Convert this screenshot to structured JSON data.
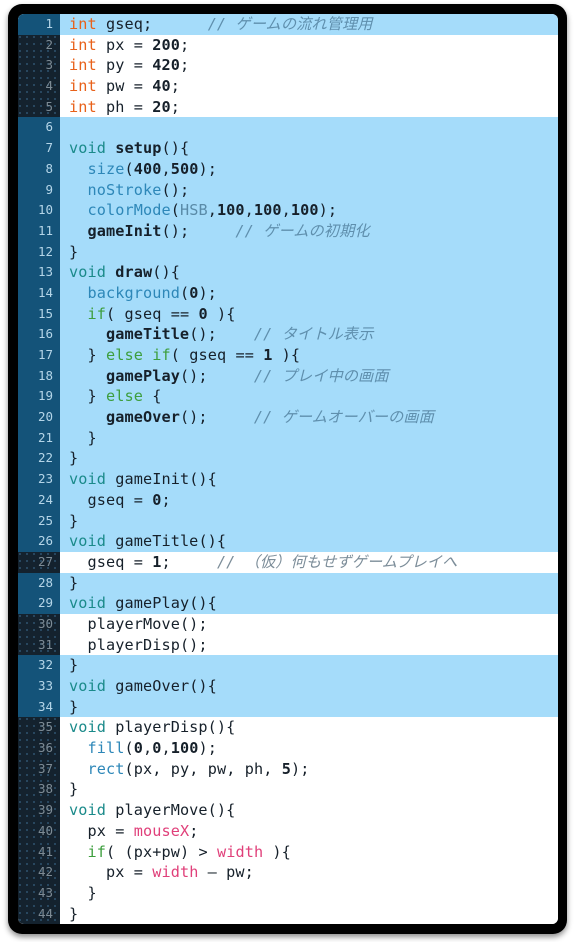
{
  "editor": {
    "name": "code-screenshot",
    "language": "Processing (Java)",
    "colors": {
      "frame": "#000000",
      "line_bg": "#ffffff",
      "line_bg_highlight": "#a5dcfa",
      "gutter_bg": "#14222e",
      "gutter_bg_highlight": "#145379",
      "gutter_text": "#7d8b95",
      "text": "#16202a",
      "type_keyword": "#e8611a",
      "void_keyword": "#1a8a8a",
      "builtin_function": "#2d87b8",
      "control_keyword": "#3d9e3d",
      "constant": "#6f8a99",
      "special_variable": "#e0407a",
      "comment": "#7c8d99"
    },
    "first_line_number": 1,
    "last_line_number": 44,
    "total_lines": 44
  },
  "lines": [
    {
      "n": "1",
      "hl": true,
      "tokens": [
        {
          "c": "t-type",
          "t": "int"
        },
        {
          "c": "t-punc",
          "t": " "
        },
        {
          "c": "t-var",
          "t": "gseq"
        },
        {
          "c": "t-punc",
          "t": ";"
        },
        {
          "c": "t-punc",
          "t": "      "
        },
        {
          "c": "t-comment",
          "t": "// ゲームの流れ管理用"
        }
      ]
    },
    {
      "n": "2",
      "hl": false,
      "tokens": [
        {
          "c": "t-type",
          "t": "int"
        },
        {
          "c": "t-punc",
          "t": " "
        },
        {
          "c": "t-var",
          "t": "px"
        },
        {
          "c": "t-punc",
          "t": " = "
        },
        {
          "c": "t-num",
          "t": "200"
        },
        {
          "c": "t-punc",
          "t": ";"
        }
      ]
    },
    {
      "n": "3",
      "hl": false,
      "tokens": [
        {
          "c": "t-type",
          "t": "int"
        },
        {
          "c": "t-punc",
          "t": " "
        },
        {
          "c": "t-var",
          "t": "py"
        },
        {
          "c": "t-punc",
          "t": " = "
        },
        {
          "c": "t-num",
          "t": "420"
        },
        {
          "c": "t-punc",
          "t": ";"
        }
      ]
    },
    {
      "n": "4",
      "hl": false,
      "tokens": [
        {
          "c": "t-type",
          "t": "int"
        },
        {
          "c": "t-punc",
          "t": " "
        },
        {
          "c": "t-var",
          "t": "pw"
        },
        {
          "c": "t-punc",
          "t": " = "
        },
        {
          "c": "t-num",
          "t": "40"
        },
        {
          "c": "t-punc",
          "t": ";"
        }
      ]
    },
    {
      "n": "5",
      "hl": false,
      "tokens": [
        {
          "c": "t-type",
          "t": "int"
        },
        {
          "c": "t-punc",
          "t": " "
        },
        {
          "c": "t-var",
          "t": "ph"
        },
        {
          "c": "t-punc",
          "t": " = "
        },
        {
          "c": "t-num",
          "t": "20"
        },
        {
          "c": "t-punc",
          "t": ";"
        }
      ]
    },
    {
      "n": "6",
      "hl": true,
      "tokens": []
    },
    {
      "n": "7",
      "hl": true,
      "tokens": [
        {
          "c": "t-void",
          "t": "void"
        },
        {
          "c": "t-punc",
          "t": " "
        },
        {
          "c": "t-fn",
          "t": "setup"
        },
        {
          "c": "t-punc",
          "t": "(){"
        }
      ]
    },
    {
      "n": "8",
      "hl": true,
      "tokens": [
        {
          "c": "t-punc",
          "t": "  "
        },
        {
          "c": "t-builtin",
          "t": "size"
        },
        {
          "c": "t-punc",
          "t": "("
        },
        {
          "c": "t-num",
          "t": "400"
        },
        {
          "c": "t-punc",
          "t": ","
        },
        {
          "c": "t-num",
          "t": "500"
        },
        {
          "c": "t-punc",
          "t": ");"
        }
      ]
    },
    {
      "n": "9",
      "hl": true,
      "tokens": [
        {
          "c": "t-punc",
          "t": "  "
        },
        {
          "c": "t-builtin",
          "t": "noStroke"
        },
        {
          "c": "t-punc",
          "t": "();"
        }
      ]
    },
    {
      "n": "10",
      "hl": true,
      "tokens": [
        {
          "c": "t-punc",
          "t": "  "
        },
        {
          "c": "t-builtin",
          "t": "colorMode"
        },
        {
          "c": "t-punc",
          "t": "("
        },
        {
          "c": "t-const",
          "t": "HSB"
        },
        {
          "c": "t-punc",
          "t": ","
        },
        {
          "c": "t-num",
          "t": "100"
        },
        {
          "c": "t-punc",
          "t": ","
        },
        {
          "c": "t-num",
          "t": "100"
        },
        {
          "c": "t-punc",
          "t": ","
        },
        {
          "c": "t-num",
          "t": "100"
        },
        {
          "c": "t-punc",
          "t": ");"
        }
      ]
    },
    {
      "n": "11",
      "hl": true,
      "tokens": [
        {
          "c": "t-punc",
          "t": "  "
        },
        {
          "c": "t-fn",
          "t": "gameInit"
        },
        {
          "c": "t-punc",
          "t": "();"
        },
        {
          "c": "t-punc",
          "t": "     "
        },
        {
          "c": "t-comment",
          "t": "// ゲームの初期化"
        }
      ]
    },
    {
      "n": "12",
      "hl": true,
      "tokens": [
        {
          "c": "t-punc",
          "t": "}"
        }
      ]
    },
    {
      "n": "13",
      "hl": true,
      "tokens": [
        {
          "c": "t-void",
          "t": "void"
        },
        {
          "c": "t-punc",
          "t": " "
        },
        {
          "c": "t-fn",
          "t": "draw"
        },
        {
          "c": "t-punc",
          "t": "(){"
        }
      ]
    },
    {
      "n": "14",
      "hl": true,
      "tokens": [
        {
          "c": "t-punc",
          "t": "  "
        },
        {
          "c": "t-builtin",
          "t": "background"
        },
        {
          "c": "t-punc",
          "t": "("
        },
        {
          "c": "t-num",
          "t": "0"
        },
        {
          "c": "t-punc",
          "t": ");"
        }
      ]
    },
    {
      "n": "15",
      "hl": true,
      "tokens": [
        {
          "c": "t-punc",
          "t": "  "
        },
        {
          "c": "t-kw",
          "t": "if"
        },
        {
          "c": "t-punc",
          "t": "( "
        },
        {
          "c": "t-var",
          "t": "gseq"
        },
        {
          "c": "t-punc",
          "t": " == "
        },
        {
          "c": "t-num",
          "t": "0"
        },
        {
          "c": "t-punc",
          "t": " ){"
        }
      ]
    },
    {
      "n": "16",
      "hl": true,
      "tokens": [
        {
          "c": "t-punc",
          "t": "    "
        },
        {
          "c": "t-fn",
          "t": "gameTitle"
        },
        {
          "c": "t-punc",
          "t": "();"
        },
        {
          "c": "t-punc",
          "t": "    "
        },
        {
          "c": "t-comment",
          "t": "// タイトル表示"
        }
      ]
    },
    {
      "n": "17",
      "hl": true,
      "tokens": [
        {
          "c": "t-punc",
          "t": "  } "
        },
        {
          "c": "t-kw",
          "t": "else"
        },
        {
          "c": "t-punc",
          "t": " "
        },
        {
          "c": "t-kw",
          "t": "if"
        },
        {
          "c": "t-punc",
          "t": "( "
        },
        {
          "c": "t-var",
          "t": "gseq"
        },
        {
          "c": "t-punc",
          "t": " == "
        },
        {
          "c": "t-num",
          "t": "1"
        },
        {
          "c": "t-punc",
          "t": " ){"
        }
      ]
    },
    {
      "n": "18",
      "hl": true,
      "tokens": [
        {
          "c": "t-punc",
          "t": "    "
        },
        {
          "c": "t-fn",
          "t": "gamePlay"
        },
        {
          "c": "t-punc",
          "t": "();"
        },
        {
          "c": "t-punc",
          "t": "     "
        },
        {
          "c": "t-comment",
          "t": "// プレイ中の画面"
        }
      ]
    },
    {
      "n": "19",
      "hl": true,
      "tokens": [
        {
          "c": "t-punc",
          "t": "  } "
        },
        {
          "c": "t-kw",
          "t": "else"
        },
        {
          "c": "t-punc",
          "t": " {"
        }
      ]
    },
    {
      "n": "20",
      "hl": true,
      "tokens": [
        {
          "c": "t-punc",
          "t": "    "
        },
        {
          "c": "t-fn",
          "t": "gameOver"
        },
        {
          "c": "t-punc",
          "t": "();"
        },
        {
          "c": "t-punc",
          "t": "     "
        },
        {
          "c": "t-comment",
          "t": "// ゲームオーバーの画面"
        }
      ]
    },
    {
      "n": "21",
      "hl": true,
      "tokens": [
        {
          "c": "t-punc",
          "t": "  }"
        }
      ]
    },
    {
      "n": "22",
      "hl": true,
      "tokens": [
        {
          "c": "t-punc",
          "t": "}"
        }
      ]
    },
    {
      "n": "23",
      "hl": true,
      "tokens": [
        {
          "c": "t-void",
          "t": "void"
        },
        {
          "c": "t-punc",
          "t": " "
        },
        {
          "c": "t-var",
          "t": "gameInit"
        },
        {
          "c": "t-punc",
          "t": "(){"
        }
      ]
    },
    {
      "n": "24",
      "hl": true,
      "tokens": [
        {
          "c": "t-punc",
          "t": "  "
        },
        {
          "c": "t-var",
          "t": "gseq"
        },
        {
          "c": "t-punc",
          "t": " = "
        },
        {
          "c": "t-num",
          "t": "0"
        },
        {
          "c": "t-punc",
          "t": ";"
        }
      ]
    },
    {
      "n": "25",
      "hl": true,
      "tokens": [
        {
          "c": "t-punc",
          "t": "}"
        }
      ]
    },
    {
      "n": "26",
      "hl": true,
      "tokens": [
        {
          "c": "t-void",
          "t": "void"
        },
        {
          "c": "t-punc",
          "t": " "
        },
        {
          "c": "t-var",
          "t": "gameTitle"
        },
        {
          "c": "t-punc",
          "t": "(){"
        }
      ]
    },
    {
      "n": "27",
      "hl": false,
      "tokens": [
        {
          "c": "t-punc",
          "t": "  "
        },
        {
          "c": "t-var",
          "t": "gseq"
        },
        {
          "c": "t-punc",
          "t": " = "
        },
        {
          "c": "t-num",
          "t": "1"
        },
        {
          "c": "t-punc",
          "t": ";"
        },
        {
          "c": "t-punc",
          "t": "     "
        },
        {
          "c": "t-comment",
          "t": "// （仮）何もせずゲームプレイへ"
        }
      ]
    },
    {
      "n": "28",
      "hl": true,
      "tokens": [
        {
          "c": "t-punc",
          "t": "}"
        }
      ]
    },
    {
      "n": "29",
      "hl": true,
      "tokens": [
        {
          "c": "t-void",
          "t": "void"
        },
        {
          "c": "t-punc",
          "t": " "
        },
        {
          "c": "t-var",
          "t": "gamePlay"
        },
        {
          "c": "t-punc",
          "t": "(){"
        }
      ]
    },
    {
      "n": "30",
      "hl": false,
      "tokens": [
        {
          "c": "t-punc",
          "t": "  "
        },
        {
          "c": "t-var",
          "t": "playerMove"
        },
        {
          "c": "t-punc",
          "t": "();"
        }
      ]
    },
    {
      "n": "31",
      "hl": false,
      "tokens": [
        {
          "c": "t-punc",
          "t": "  "
        },
        {
          "c": "t-var",
          "t": "playerDisp"
        },
        {
          "c": "t-punc",
          "t": "();"
        }
      ]
    },
    {
      "n": "32",
      "hl": true,
      "tokens": [
        {
          "c": "t-punc",
          "t": "}"
        }
      ]
    },
    {
      "n": "33",
      "hl": true,
      "tokens": [
        {
          "c": "t-void",
          "t": "void"
        },
        {
          "c": "t-punc",
          "t": " "
        },
        {
          "c": "t-var",
          "t": "gameOver"
        },
        {
          "c": "t-punc",
          "t": "(){"
        }
      ]
    },
    {
      "n": "34",
      "hl": true,
      "tokens": [
        {
          "c": "t-punc",
          "t": "}"
        }
      ]
    },
    {
      "n": "35",
      "hl": false,
      "tokens": [
        {
          "c": "t-void",
          "t": "void"
        },
        {
          "c": "t-punc",
          "t": " "
        },
        {
          "c": "t-var",
          "t": "playerDisp"
        },
        {
          "c": "t-punc",
          "t": "(){"
        }
      ]
    },
    {
      "n": "36",
      "hl": false,
      "tokens": [
        {
          "c": "t-punc",
          "t": "  "
        },
        {
          "c": "t-builtin",
          "t": "fill"
        },
        {
          "c": "t-punc",
          "t": "("
        },
        {
          "c": "t-num",
          "t": "0"
        },
        {
          "c": "t-punc",
          "t": ","
        },
        {
          "c": "t-num",
          "t": "0"
        },
        {
          "c": "t-punc",
          "t": ","
        },
        {
          "c": "t-num",
          "t": "100"
        },
        {
          "c": "t-punc",
          "t": ");"
        }
      ]
    },
    {
      "n": "37",
      "hl": false,
      "tokens": [
        {
          "c": "t-punc",
          "t": "  "
        },
        {
          "c": "t-builtin",
          "t": "rect"
        },
        {
          "c": "t-punc",
          "t": "("
        },
        {
          "c": "t-var",
          "t": "px"
        },
        {
          "c": "t-punc",
          "t": ", "
        },
        {
          "c": "t-var",
          "t": "py"
        },
        {
          "c": "t-punc",
          "t": ", "
        },
        {
          "c": "t-var",
          "t": "pw"
        },
        {
          "c": "t-punc",
          "t": ", "
        },
        {
          "c": "t-var",
          "t": "ph"
        },
        {
          "c": "t-punc",
          "t": ", "
        },
        {
          "c": "t-num",
          "t": "5"
        },
        {
          "c": "t-punc",
          "t": ");"
        }
      ]
    },
    {
      "n": "38",
      "hl": false,
      "tokens": [
        {
          "c": "t-punc",
          "t": "}"
        }
      ]
    },
    {
      "n": "39",
      "hl": false,
      "tokens": [
        {
          "c": "t-void",
          "t": "void"
        },
        {
          "c": "t-punc",
          "t": " "
        },
        {
          "c": "t-var",
          "t": "playerMove"
        },
        {
          "c": "t-punc",
          "t": "(){"
        }
      ]
    },
    {
      "n": "40",
      "hl": false,
      "tokens": [
        {
          "c": "t-punc",
          "t": "  "
        },
        {
          "c": "t-var",
          "t": "px"
        },
        {
          "c": "t-punc",
          "t": " = "
        },
        {
          "c": "t-special",
          "t": "mouseX"
        },
        {
          "c": "t-punc",
          "t": ";"
        }
      ]
    },
    {
      "n": "41",
      "hl": false,
      "tokens": [
        {
          "c": "t-punc",
          "t": "  "
        },
        {
          "c": "t-kw",
          "t": "if"
        },
        {
          "c": "t-punc",
          "t": "( ("
        },
        {
          "c": "t-var",
          "t": "px"
        },
        {
          "c": "t-punc",
          "t": "+"
        },
        {
          "c": "t-var",
          "t": "pw"
        },
        {
          "c": "t-punc",
          "t": ") > "
        },
        {
          "c": "t-special",
          "t": "width"
        },
        {
          "c": "t-punc",
          "t": " ){"
        }
      ]
    },
    {
      "n": "42",
      "hl": false,
      "tokens": [
        {
          "c": "t-punc",
          "t": "    "
        },
        {
          "c": "t-var",
          "t": "px"
        },
        {
          "c": "t-punc",
          "t": " = "
        },
        {
          "c": "t-special",
          "t": "width"
        },
        {
          "c": "t-punc",
          "t": " – "
        },
        {
          "c": "t-var",
          "t": "pw"
        },
        {
          "c": "t-punc",
          "t": ";"
        }
      ]
    },
    {
      "n": "43",
      "hl": false,
      "tokens": [
        {
          "c": "t-punc",
          "t": "  }"
        }
      ]
    },
    {
      "n": "44",
      "hl": false,
      "tokens": [
        {
          "c": "t-punc",
          "t": "}"
        }
      ]
    }
  ]
}
